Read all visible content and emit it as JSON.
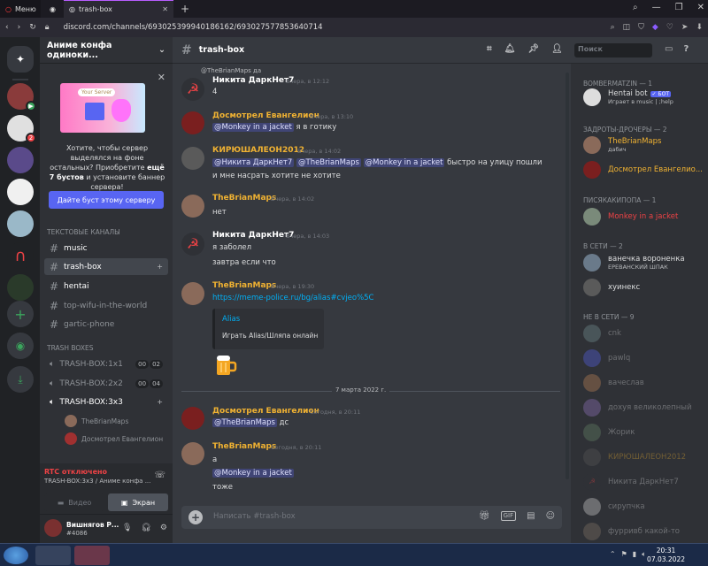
{
  "browser": {
    "menu_tab": "Меню",
    "active_tab": "trash-box",
    "url": "discord.com/channels/693025399940186162/693027577853640714"
  },
  "guild": {
    "name": "Аниме конфа одиноки...",
    "boost_pill": "Your Server",
    "boost_text_pre": "Хотите, чтобы сервер выделялся на фоне остальных? Приобретите ",
    "boost_text_bold": "ещё 7 бустов",
    "boost_text_post": " и установите баннер сервера!",
    "boost_button": "Дайте буст этому серверу",
    "text_category": "ТЕКСТОВЫЕ КАНАЛЫ",
    "text_channels": [
      "music",
      "trash-box",
      "hentai",
      "top-wifu-in-the-world",
      "gartic-phone"
    ],
    "voice_category": "TRASH BOXES",
    "voice_channels": [
      {
        "name": "TRASH-BOX:1x1",
        "a": "00",
        "b": "02"
      },
      {
        "name": "TRASH-BOX:2x2",
        "a": "00",
        "b": "04"
      },
      {
        "name": "TRASH-BOX:3x3"
      }
    ],
    "voice_users": [
      "TheBrianMaps",
      "Досмотрел Евангелион"
    ]
  },
  "voice_panel": {
    "status": "RTC отключено",
    "sub": "TRASH-BOX:3x3 / Аниме конфа ...",
    "video": "Видео",
    "screen": "Экран"
  },
  "user": {
    "name": "Вишнягов Р...",
    "tag": "#4086"
  },
  "chat": {
    "channel": "trash-box",
    "search_placeholder": "Поиск",
    "reply_preview": "@TheBrianMaps да",
    "messages": [
      {
        "author": "Никита ДаркНет7",
        "time": "Вчера, в 12:12",
        "lines": [
          "4"
        ]
      },
      {
        "author": "Досмотрел Евангелион",
        "time": "Вчера, в 13:10",
        "mention": "@Monkey in a jacket",
        "text": " я в готику"
      },
      {
        "author": "КИРЮШАЛЕОН2012",
        "time": "Вчера, в 14:02",
        "m1": "@Никита ДаркНет7",
        "m2": "@TheBrianMaps",
        "m3": "@Monkey in a jacket",
        "text": " быстро на улицу пошли",
        "line2": "и мне насрать хотите не хотите"
      },
      {
        "author": "TheBrianMaps",
        "time": "Вчера, в 14:02",
        "lines": [
          "нет"
        ]
      },
      {
        "author": "Никита ДаркНет7",
        "time": "Вчера, в 14:03",
        "lines": [
          "я заболел",
          "завтра если что"
        ]
      },
      {
        "author": "TheBrianMaps",
        "time": "Вчера, в 19:30",
        "link": "https://meme-police.ru/bg/alias#cvjeo%5C"
      },
      {
        "author": "Досмотрел Евангелион",
        "time": "Сегодня, в 20:11",
        "mention": "@TheBrianMaps",
        "text": " дс"
      },
      {
        "author": "TheBrianMaps",
        "time": "Сегодня, в 20:11",
        "lines": [
          "а"
        ],
        "mention": "@Monkey in a jacket",
        "last": "тоже"
      }
    ],
    "embed_title": "Alias",
    "embed_desc": "Играть Alias/Шляпа онлайн",
    "date_divider": "7 марта 2022 г.",
    "composer_placeholder": "Написать #trash-box"
  },
  "members": {
    "cat1": "BOMBERMATZIN — 1",
    "bot_name": "Hentai bot",
    "bot_tag": "✓ БОТ",
    "bot_sub": "Играет в music | ;help",
    "cat2": "ЗАДРОТЫ-ДРОЧЕРЫ — 2",
    "m_brian": "TheBrianMaps",
    "m_brian_sub": "дабич",
    "m_evang": "Досмотрел Евангелио...",
    "cat3": "ПИСЯКАКИПОПА — 1",
    "m_monkey": "Monkey in a jacket",
    "cat4": "В СЕТИ — 2",
    "m_vanechka": "ванечка вороненка",
    "m_vanechka_sub": "ЕРЕВАНСКИЙ ШПАК",
    "m_huinex": "хуинекс",
    "cat5": "НЕ В СЕТИ — 9",
    "offline": [
      "cnk",
      "pawlq",
      "вачеслав",
      "дохуя великолепный",
      "Жорик",
      "КИРЮШАЛЕОН2012",
      "Никита ДаркНет7",
      "сирупчка",
      "фурривб какой-то"
    ]
  },
  "taskbar": {
    "time": "20:31",
    "date": "07.03.2022"
  },
  "colors": {
    "blurple": "#5865f2",
    "mention_yellow": "#f0b232",
    "monkey_red": "#ed4245",
    "chat_bg": "#36393f"
  }
}
